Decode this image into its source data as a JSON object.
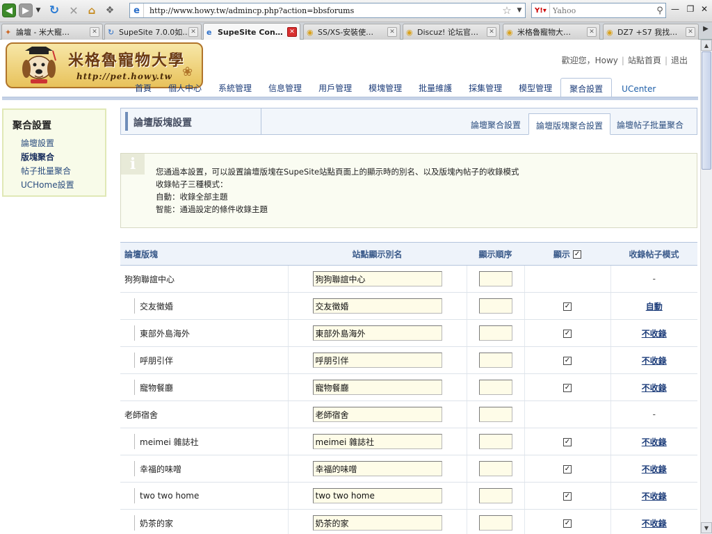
{
  "browser": {
    "url": "http://www.howy.tw/admincp.php?action=bbsforums",
    "search_placeholder": "Yahoo",
    "search_engine": "Y!",
    "tabs": [
      {
        "label": "論壇 - 米大寵…",
        "icon": "forum-icon"
      },
      {
        "label": "SupeSite 7.0.0如…",
        "icon": "refresh-icon"
      },
      {
        "label": "SupeSite Con…",
        "icon": "ie-icon",
        "active": true
      },
      {
        "label": "SS/XS-安裝使…",
        "icon": "folder-icon"
      },
      {
        "label": "Discuz! 论坛官…",
        "icon": "folder-icon"
      },
      {
        "label": "米格魯寵物大…",
        "icon": "folder-icon"
      },
      {
        "label": "DZ7 +S7 我找…",
        "icon": "folder-icon"
      }
    ]
  },
  "site": {
    "logo_title": "米格魯寵物大學",
    "logo_url": "http://pet.howy.tw",
    "welcome": "歡迎您，Howy",
    "home_link": "站點首頁",
    "logout_link": "退出"
  },
  "nav": [
    "首頁",
    "個人中心",
    "系統管理",
    "信息管理",
    "用戶管理",
    "模塊管理",
    "批量維護",
    "採集管理",
    "模型管理",
    "聚合設置",
    "UCenter"
  ],
  "nav_active": "聚合設置",
  "sidemenu": {
    "title": "聚合設置",
    "items": [
      "論壇設置",
      "版塊聚合",
      "帖子批量聚合",
      "UCHome設置"
    ],
    "active": "版塊聚合"
  },
  "content": {
    "heading": "論壇版塊設置",
    "subtabs": [
      "論壇聚合設置",
      "論壇版塊聚合設置",
      "論壇帖子批量聚合"
    ],
    "active_subtab": "論壇版塊聚合設置",
    "tips": [
      "您通過本設置，可以設置論壇版塊在SupeSite站點頁面上的顯示時的別名、以及版塊內帖子的收錄模式",
      "收錄帖子三種模式：",
      "自動：收錄全部主題",
      "智能：通過設定的條件收錄主題"
    ]
  },
  "table": {
    "columns": [
      "論壇版塊",
      "站點顯示別名",
      "顯示順序",
      "顯示",
      "收錄帖子模式"
    ],
    "rows": [
      {
        "name": "狗狗聯誼中心",
        "alias": "狗狗聯誼中心",
        "order": "",
        "show": null,
        "mode": "-",
        "child": false
      },
      {
        "name": "交友徵婚",
        "alias": "交友徵婚",
        "order": "",
        "show": true,
        "mode": "自動",
        "child": true
      },
      {
        "name": "東部外島海外",
        "alias": "東部外島海外",
        "order": "",
        "show": true,
        "mode": "不收錄",
        "child": true
      },
      {
        "name": "呼朋引伴",
        "alias": "呼朋引伴",
        "order": "",
        "show": true,
        "mode": "不收錄",
        "child": true
      },
      {
        "name": "寵物餐廳",
        "alias": "寵物餐廳",
        "order": "",
        "show": true,
        "mode": "不收錄",
        "child": true
      },
      {
        "name": "老師宿舍",
        "alias": "老師宿舍",
        "order": "",
        "show": null,
        "mode": "-",
        "child": false
      },
      {
        "name": "meimei 雜誌社",
        "alias": "meimei 雜誌社",
        "order": "",
        "show": true,
        "mode": "不收錄",
        "child": true
      },
      {
        "name": "幸福的味噌",
        "alias": "幸福的味噌",
        "order": "",
        "show": true,
        "mode": "不收錄",
        "child": true
      },
      {
        "name": "two two home",
        "alias": "two two home",
        "order": "",
        "show": true,
        "mode": "不收錄",
        "child": true
      },
      {
        "name": "奶茶的家",
        "alias": "奶茶的家",
        "order": "",
        "show": true,
        "mode": "不收錄",
        "child": true
      }
    ]
  }
}
